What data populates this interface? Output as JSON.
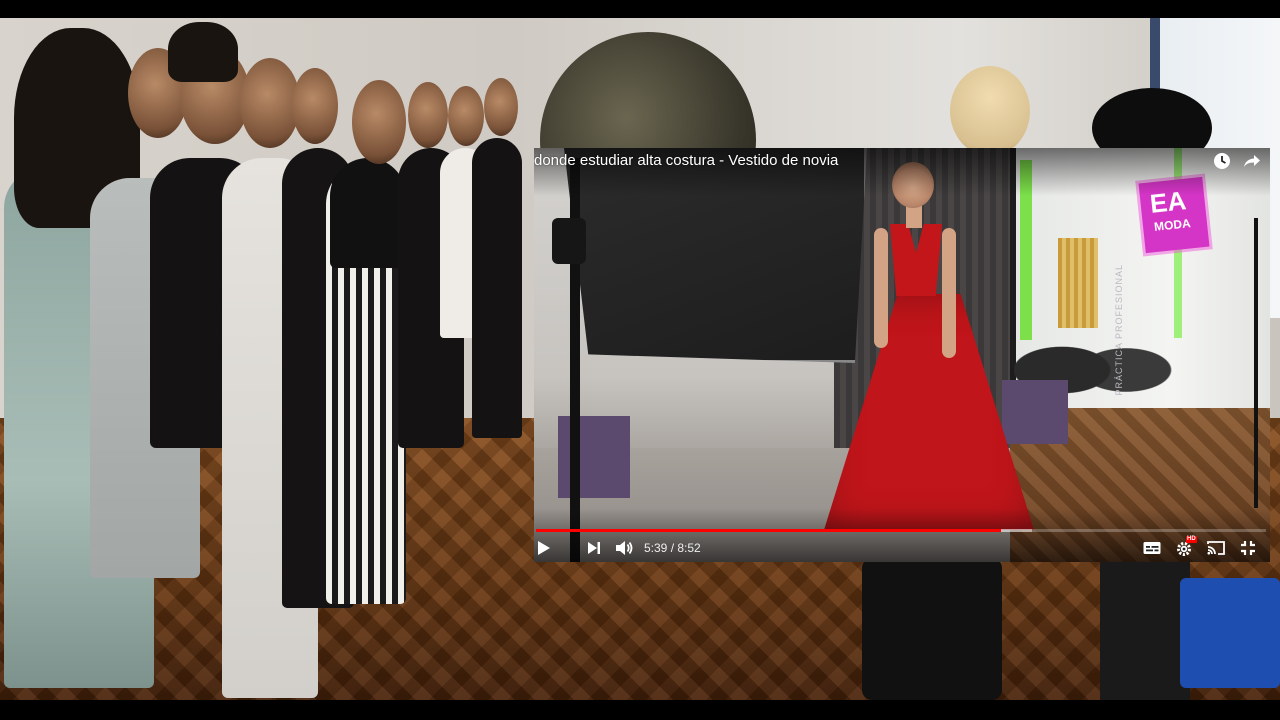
{
  "video": {
    "title": "donde estudiar alta costura - Vestido de novia",
    "current_time": "5:39",
    "duration": "8:52",
    "time_separator": " / ",
    "played_fraction": 0.637,
    "buffered_fraction": 0.679,
    "progress_color": "#ff0000",
    "quality_badge": "HD"
  },
  "watermark": {
    "brand": "EA",
    "subtitle": "MODA",
    "vertical_text": "PRÁCTICA PROFESIONAL",
    "color": "#d535c7"
  },
  "icons": {
    "watch_later": "clock-icon",
    "share": "share-icon",
    "play": "play-icon",
    "next": "next-icon",
    "volume": "volume-icon",
    "subtitles": "subtitles-icon",
    "settings": "gear-icon",
    "cast": "cast-icon",
    "fullscreen_exit": "exit-fullscreen-icon"
  }
}
